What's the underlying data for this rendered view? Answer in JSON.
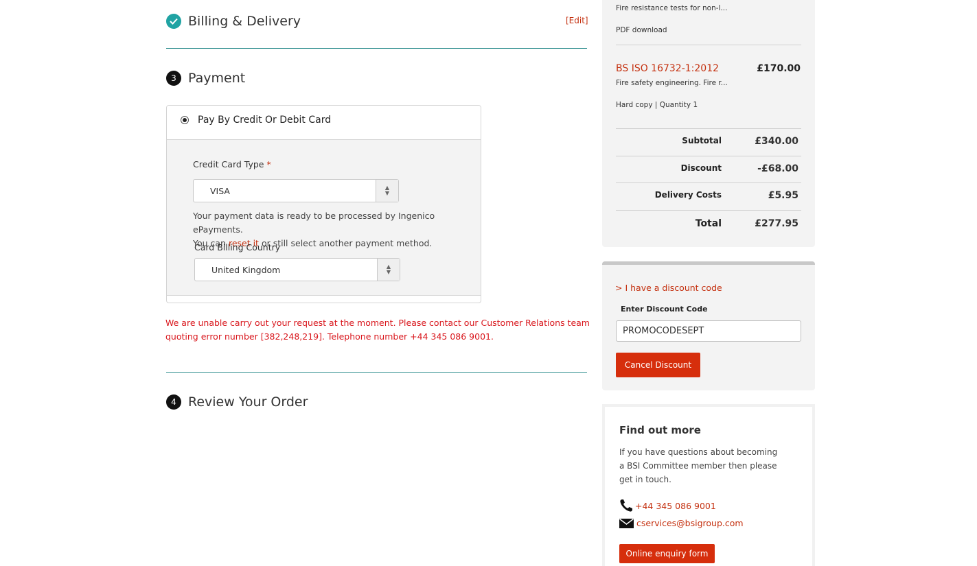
{
  "billing": {
    "title": "Billing & Delivery",
    "edit_label": "[Edit]"
  },
  "payment": {
    "step_number": "3",
    "title": "Payment",
    "method_label": "Pay By Credit Or Debit Card",
    "card_type_label": "Credit Card Type",
    "required_marker": "*",
    "card_type_value": "VISA",
    "info_line1": "Your payment data is ready to be processed by Ingenico ePayments.",
    "info_line2_prefix": "You can ",
    "info_reset_link": "reset it",
    "info_line2_suffix": " or still select another payment method.",
    "country_label": "Card Billing Country",
    "country_value": "United Kingdom",
    "error_message": "We are unable carry out your request at the moment. Please contact our Customer Relations team quoting error number [382,248,219]. Telephone number +44 345 086 9001."
  },
  "review": {
    "step_number": "4",
    "title": "Review Your Order"
  },
  "summary": {
    "item1_desc": "Fire resistance tests for non-l...",
    "item1_format": "PDF download",
    "item2_name": "BS ISO 16732-1:2012",
    "item2_price": "£170.00",
    "item2_desc": "Fire safety engineering. Fire r...",
    "item2_format": "Hard copy | Quantity 1",
    "subtotal_label": "Subtotal",
    "subtotal_value": "£340.00",
    "discount_label": "Discount",
    "discount_value": "-£68.00",
    "delivery_label": "Delivery Costs",
    "delivery_value": "£5.95",
    "total_label": "Total",
    "total_value": "£277.95"
  },
  "discount": {
    "toggle_label": "> I have a discount code",
    "field_label": "Enter Discount Code",
    "code_value": "PROMOCODESEPT",
    "cancel_label": "Cancel Discount"
  },
  "findout": {
    "title": "Find out more",
    "text": "If you have questions about becoming a BSI Committee member then please get in touch.",
    "phone": "+44 345 086 9001",
    "email": "cservices@bsigroup.com",
    "enquiry_label": "Online enquiry form"
  },
  "colors": {
    "accent_teal": "#20a3a3",
    "brand_red": "#d62e0c",
    "error_red": "#d9161c"
  }
}
